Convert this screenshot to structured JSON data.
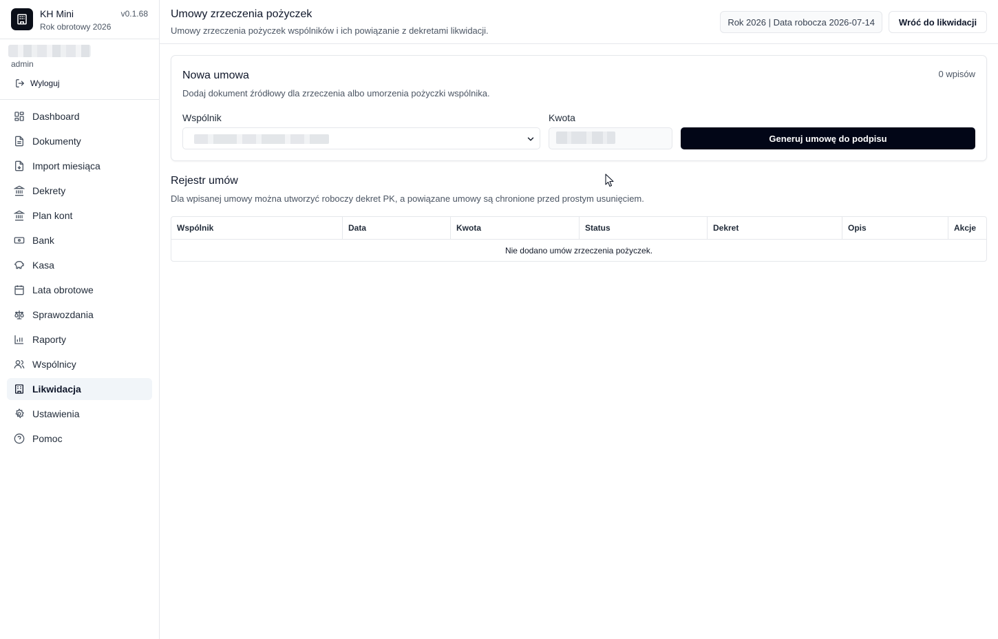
{
  "app": {
    "name": "KH Mini",
    "fiscal_year": "Rok obrotowy 2026",
    "version": "v0.1.68"
  },
  "user": {
    "role": "admin",
    "logout_label": "Wyloguj"
  },
  "sidebar": {
    "items": [
      {
        "label": "Dashboard",
        "icon": "dashboard-icon"
      },
      {
        "label": "Dokumenty",
        "icon": "document-icon"
      },
      {
        "label": "Import miesiąca",
        "icon": "import-icon"
      },
      {
        "label": "Dekrety",
        "icon": "landmark-icon"
      },
      {
        "label": "Plan kont",
        "icon": "landmark-icon"
      },
      {
        "label": "Bank",
        "icon": "banknote-icon"
      },
      {
        "label": "Kasa",
        "icon": "piggy-bank-icon"
      },
      {
        "label": "Lata obrotowe",
        "icon": "calendar-icon"
      },
      {
        "label": "Sprawozdania",
        "icon": "scale-icon"
      },
      {
        "label": "Raporty",
        "icon": "bar-chart-icon"
      },
      {
        "label": "Wspólnicy",
        "icon": "users-icon"
      },
      {
        "label": "Likwidacja",
        "icon": "building-icon",
        "active": true
      },
      {
        "label": "Ustawienia",
        "icon": "gear-icon"
      },
      {
        "label": "Pomoc",
        "icon": "help-icon"
      }
    ]
  },
  "header": {
    "title": "Umowy zrzeczenia pożyczek",
    "subtitle": "Umowy zrzeczenia pożyczek wspólników i ich powiązanie z dekretami likwidacji.",
    "year_info": "Rok 2026 | Data robocza 2026-07-14",
    "back_label": "Wróć do likwidacji"
  },
  "new_contract": {
    "title": "Nowa umowa",
    "count": "0 wpisów",
    "description": "Dodaj dokument źródłowy dla zrzeczenia albo umorzenia pożyczki wspólnika.",
    "partner_label": "Wspólnik",
    "amount_label": "Kwota",
    "generate_label": "Generuj umowę do podpisu"
  },
  "register": {
    "title": "Rejestr umów",
    "description": "Dla wpisanej umowy można utworzyć roboczy dekret PK, a powiązane umowy są chronione przed prostym usunięciem.",
    "columns": [
      "Wspólnik",
      "Data",
      "Kwota",
      "Status",
      "Dekret",
      "Opis",
      "Akcje"
    ],
    "empty_message": "Nie dodano umów zrzeczenia pożyczek."
  }
}
